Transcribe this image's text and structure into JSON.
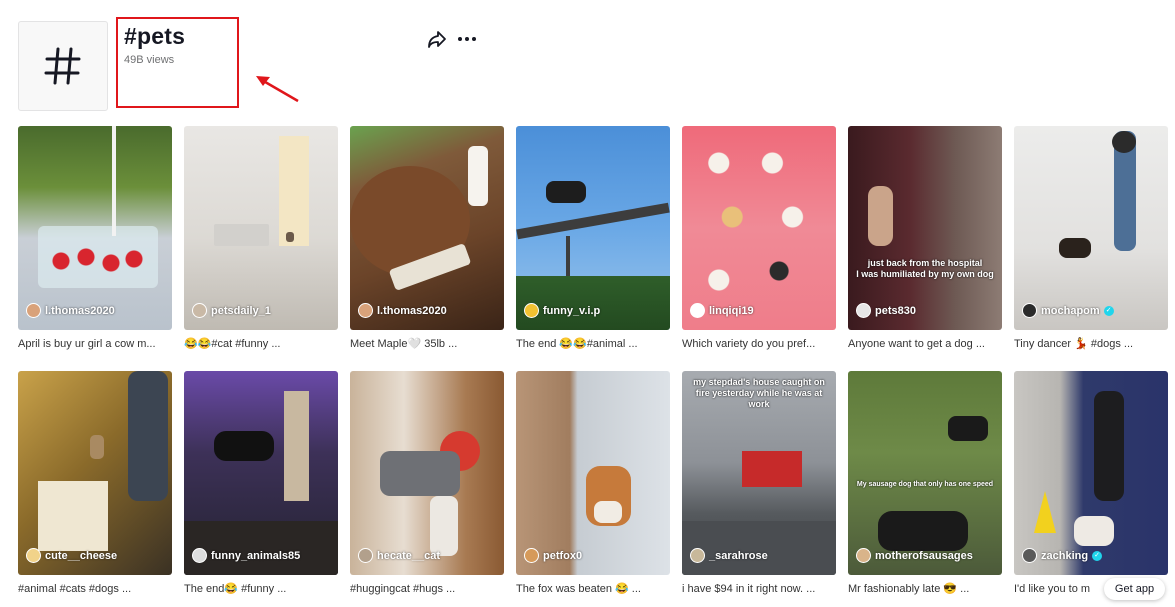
{
  "hashtag": {
    "title": "#pets",
    "views": "49B views",
    "icon": "hash-icon"
  },
  "actions": {
    "share_icon": "share-arrow-icon",
    "more_icon": "more-dots-icon"
  },
  "annotation": {
    "color": "#e0161b"
  },
  "videos": [
    {
      "user": "l.thomas2020",
      "caption": "April is buy ur girl a cow m...",
      "verified": false
    },
    {
      "user": "petsdaily_1",
      "caption": "😂😂#cat #funny ...",
      "verified": false
    },
    {
      "user": "l.thomas2020",
      "caption": "Meet Maple🤍 35lb ...",
      "verified": false
    },
    {
      "user": "funny_v.i.p",
      "caption": "The end 😂😂#animal ...",
      "verified": false
    },
    {
      "user": "linqiqi19",
      "caption": "Which variety do you pref...",
      "verified": false
    },
    {
      "user": "pets830",
      "caption": "Anyone want to get a dog ...",
      "verified": false,
      "overlay": "just back from the hospital\nI was humiliated by my own dog"
    },
    {
      "user": "mochapom",
      "caption": "Tiny dancer 💃 #dogs ...",
      "verified": true
    },
    {
      "user": "cute__cheese",
      "caption": "#animal #cats #dogs ...",
      "verified": false
    },
    {
      "user": "funny_animals85",
      "caption": "The end😂 #funny ...",
      "verified": false
    },
    {
      "user": "hecate__cat",
      "caption": "#huggingcat #hugs ...",
      "verified": false
    },
    {
      "user": "petfox0",
      "caption": "The fox was beaten 😂 ...",
      "verified": false
    },
    {
      "user": "_sarahrose",
      "caption": "i have $94 in it right now. ...",
      "verified": false,
      "overlay": "my stepdad's house caught on fire yesterday while he was at work"
    },
    {
      "user": "motherofsausages",
      "caption": "Mr fashionably late 😎 ...",
      "verified": false,
      "overlay": "My sausage dog that only has one speed"
    },
    {
      "user": "zachking",
      "caption": "I'd like you to m",
      "verified": true
    }
  ],
  "get_app": "Get app"
}
